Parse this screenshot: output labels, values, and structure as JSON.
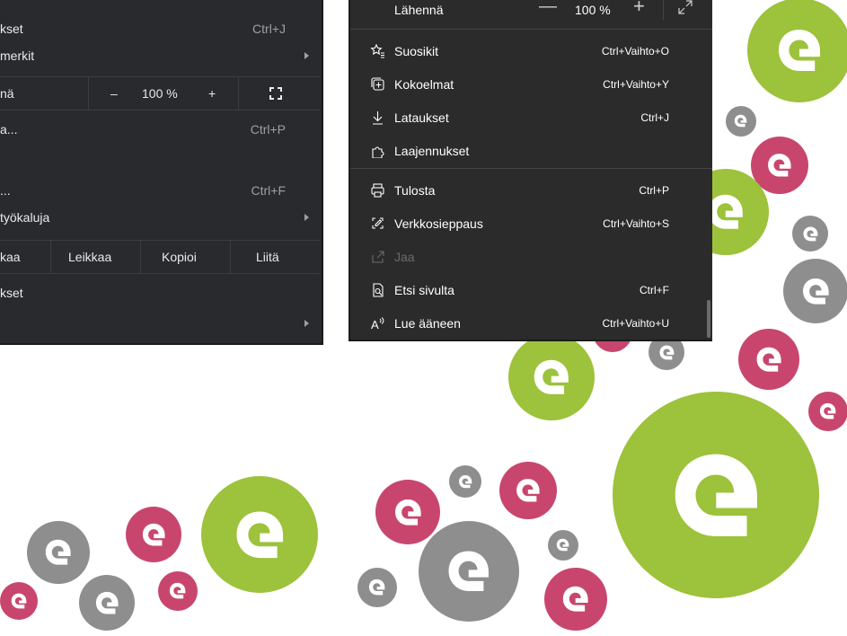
{
  "colors": {
    "green": "#9dc23b",
    "pink": "#c8466e",
    "grey": "#8e8e8e"
  },
  "chrome_menu": {
    "items": {
      "downloads": {
        "label": "kset",
        "shortcut": "Ctrl+J"
      },
      "bookmarks": {
        "label": "merkit"
      },
      "zoom": {
        "label": "nä",
        "minus": "–",
        "value": "100 %",
        "plus": "+"
      },
      "print": {
        "label": "a...",
        "shortcut": "Ctrl+P"
      },
      "find": {
        "label": "...",
        "shortcut": "Ctrl+F"
      },
      "more_tools": {
        "label": "työkaluja"
      },
      "settings": {
        "label": "kset"
      }
    },
    "edit_row": {
      "edit": "kaa",
      "cut": "Leikkaa",
      "copy": "Kopioi",
      "paste": "Liitä"
    }
  },
  "edge_menu": {
    "zoom": {
      "label": "Lähennä",
      "minus": "—",
      "value": "100 %",
      "plus": "+"
    },
    "items": [
      {
        "label": "Suosikit",
        "shortcut": "Ctrl+Vaihto+O",
        "icon": "favorites-icon"
      },
      {
        "label": "Kokoelmat",
        "shortcut": "Ctrl+Vaihto+Y",
        "icon": "collections-icon"
      },
      {
        "label": "Lataukset",
        "shortcut": "Ctrl+J",
        "icon": "downloads-icon"
      },
      {
        "label": "Laajennukset",
        "shortcut": "",
        "icon": "extensions-icon"
      },
      {
        "label": "Tulosta",
        "shortcut": "Ctrl+P",
        "icon": "print-icon"
      },
      {
        "label": "Verkkosieppaus",
        "shortcut": "Ctrl+Vaihto+S",
        "icon": "web-capture-icon"
      },
      {
        "label": "Jaa",
        "shortcut": "",
        "icon": "share-icon",
        "disabled": true
      },
      {
        "label": "Etsi sivulta",
        "shortcut": "Ctrl+F",
        "icon": "find-icon"
      },
      {
        "label": "Lue ääneen",
        "shortcut": "Ctrl+Vaihto+U",
        "icon": "read-aloud-icon"
      }
    ]
  }
}
